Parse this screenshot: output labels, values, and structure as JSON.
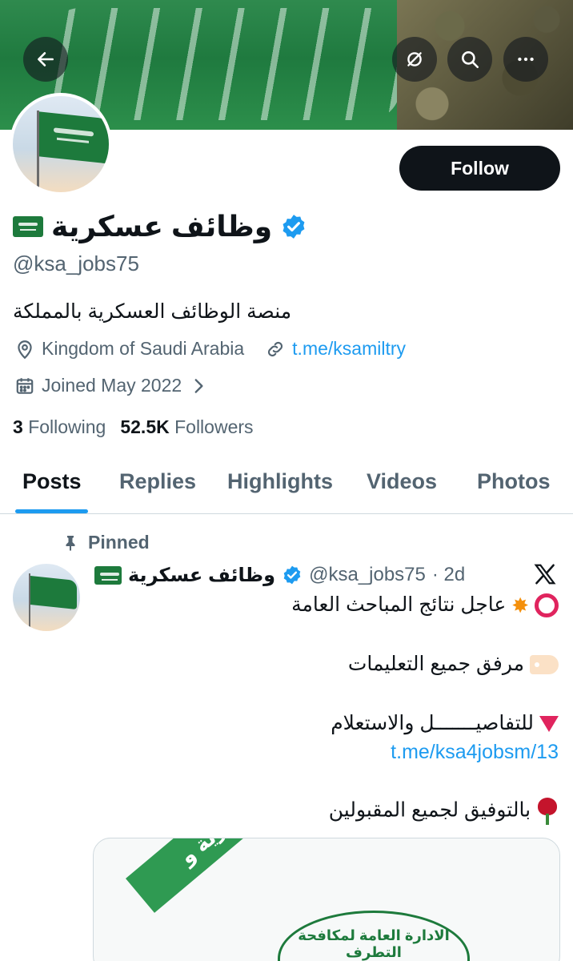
{
  "header": {
    "back_icon": "arrow-left-icon",
    "icons": [
      "rotate-icon",
      "search-icon",
      "more-icon"
    ]
  },
  "profile": {
    "follow_label": "Follow",
    "display_name": "وظائف عسكرية",
    "flag_emoji": "saudi-flag-icon",
    "handle": "@ksa_jobs75",
    "bio": "منصة الوظائف العسكرية بالمملكة",
    "location": "Kingdom of Saudi Arabia",
    "link": "t.me/ksamiltry",
    "joined": "Joined May 2022",
    "following_count": "3",
    "following_label": "Following",
    "followers_count": "52.5K",
    "followers_label": "Followers"
  },
  "tabs": [
    {
      "label": "Posts",
      "active": true
    },
    {
      "label": "Replies",
      "active": false
    },
    {
      "label": "Highlights",
      "active": false
    },
    {
      "label": "Videos",
      "active": false
    },
    {
      "label": "Photos",
      "active": false
    }
  ],
  "post": {
    "pinned_label": "Pinned",
    "author_name": "وظائف عسكرية",
    "author_handle": "@ksa_jobs75",
    "time": "· 2d",
    "lines": {
      "headline": "عاجل نتائج المباحث العامة",
      "attached": "مرفق جميع التعليمات",
      "details": "للتفاصيـــــــل والاستعلام",
      "link": "t.me/ksa4jobsm/13",
      "wish": "بالتوفيق لجميع المقبولين"
    },
    "media": {
      "ribbon_text": "تسجيل عسكرية و",
      "emblem_text": "الادارة العامة لمكافحة التطرف"
    }
  },
  "colors": {
    "accent": "#1d9bf0",
    "text": "#0f1419",
    "muted": "#536471",
    "flag_green": "#1d7a3c"
  }
}
